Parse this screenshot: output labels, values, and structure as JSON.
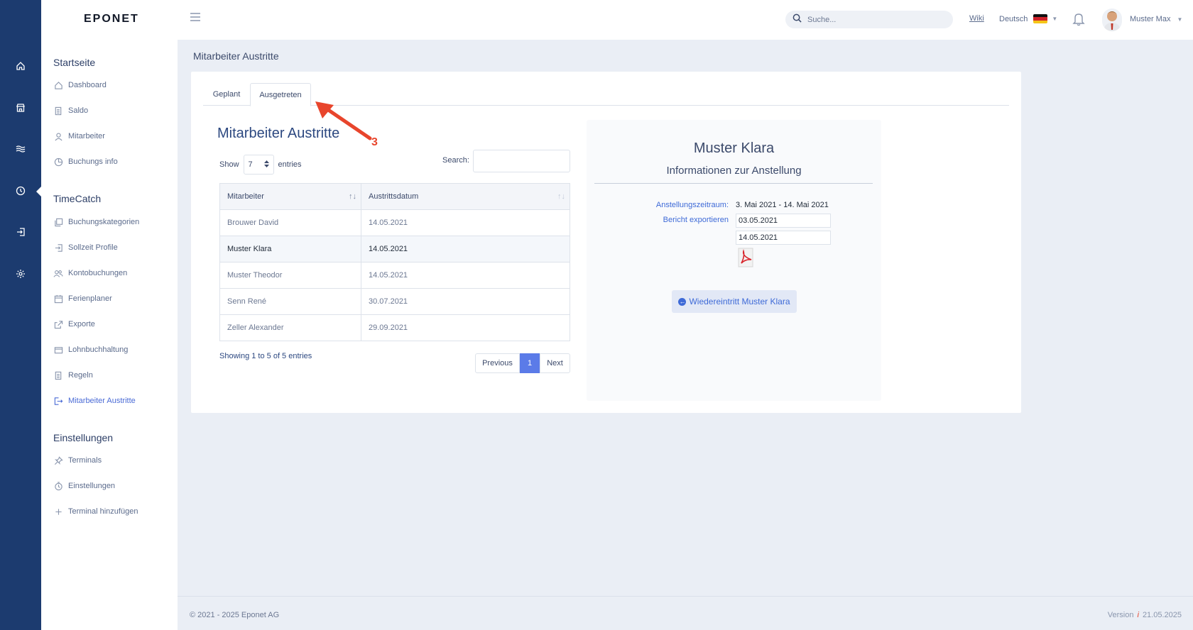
{
  "app": {
    "logo": "EPONET"
  },
  "rail": {
    "icons": [
      "home-icon",
      "store-icon",
      "waves-icon",
      "clock-icon",
      "login-icon",
      "gear-icon"
    ]
  },
  "sidebar": {
    "sections": [
      {
        "title": "Startseite",
        "items": [
          {
            "label": "Dashboard",
            "icon": "home-icon"
          },
          {
            "label": "Saldo",
            "icon": "document-icon"
          },
          {
            "label": "Mitarbeiter",
            "icon": "user-icon"
          },
          {
            "label": "Buchungs info",
            "icon": "pie-icon"
          }
        ]
      },
      {
        "title": "TimeCatch",
        "items": [
          {
            "label": "Buchungskategorien",
            "icon": "copy-icon"
          },
          {
            "label": "Sollzeit Profile",
            "icon": "login-icon"
          },
          {
            "label": "Kontobuchungen",
            "icon": "users-icon"
          },
          {
            "label": "Ferienplaner",
            "icon": "calendar-icon"
          },
          {
            "label": "Exporte",
            "icon": "export-icon"
          },
          {
            "label": "Lohnbuchhaltung",
            "icon": "wallet-icon"
          },
          {
            "label": "Regeln",
            "icon": "document-icon"
          },
          {
            "label": "Mitarbeiter Austritte",
            "icon": "logout-icon",
            "active": true
          }
        ]
      },
      {
        "title": "Einstellungen",
        "items": [
          {
            "label": "Terminals",
            "icon": "pin-icon"
          },
          {
            "label": "Einstellungen",
            "icon": "timer-icon"
          },
          {
            "label": "Terminal hinzufügen",
            "icon": "plus-icon"
          }
        ]
      }
    ]
  },
  "topbar": {
    "search_placeholder": "Suche...",
    "wiki": "Wiki",
    "language": "Deutsch",
    "user": "Muster Max"
  },
  "page": {
    "title": "Mitarbeiter Austritte"
  },
  "tabs": [
    {
      "label": "Geplant",
      "active": false
    },
    {
      "label": "Ausgetreten",
      "active": true
    }
  ],
  "list": {
    "title": "Mitarbeiter Austritte",
    "show_label": "Show",
    "page_size": "7",
    "entries_label": "entries",
    "search_label": "Search:",
    "columns": [
      "Mitarbeiter",
      "Austrittsdatum"
    ],
    "rows": [
      {
        "name": "Brouwer David",
        "date": "14.05.2021"
      },
      {
        "name": "Muster Klara",
        "date": "14.05.2021",
        "selected": true
      },
      {
        "name": "Muster Theodor",
        "date": "14.05.2021"
      },
      {
        "name": "Senn René",
        "date": "30.07.2021"
      },
      {
        "name": "Zeller Alexander",
        "date": "29.09.2021"
      }
    ],
    "info": "Showing 1 to 5 of 5 entries",
    "pager": {
      "prev": "Previous",
      "current": "1",
      "next": "Next"
    }
  },
  "detail": {
    "name": "Muster Klara",
    "subtitle": "Informationen zur Anstellung",
    "period_label": "Anstellungszeitraum:",
    "period_value": "3. Mai 2021 - 14. Mai 2021",
    "export_label": "Bericht exportieren",
    "date_from": "03.05.2021",
    "date_to": "14.05.2021",
    "reentry_button": "Wiedereintritt Muster Klara"
  },
  "annotation": {
    "number": "3",
    "color": "#e8452c"
  },
  "footer": {
    "copyright": "© 2021 - 2025 Eponet AG",
    "version_label": "Version",
    "version_sep": "i",
    "version_date": "21.05.2025"
  },
  "colors": {
    "rail": "#1c3b6f",
    "accent": "#4a6bd6",
    "pager_active": "#5b7be8"
  }
}
